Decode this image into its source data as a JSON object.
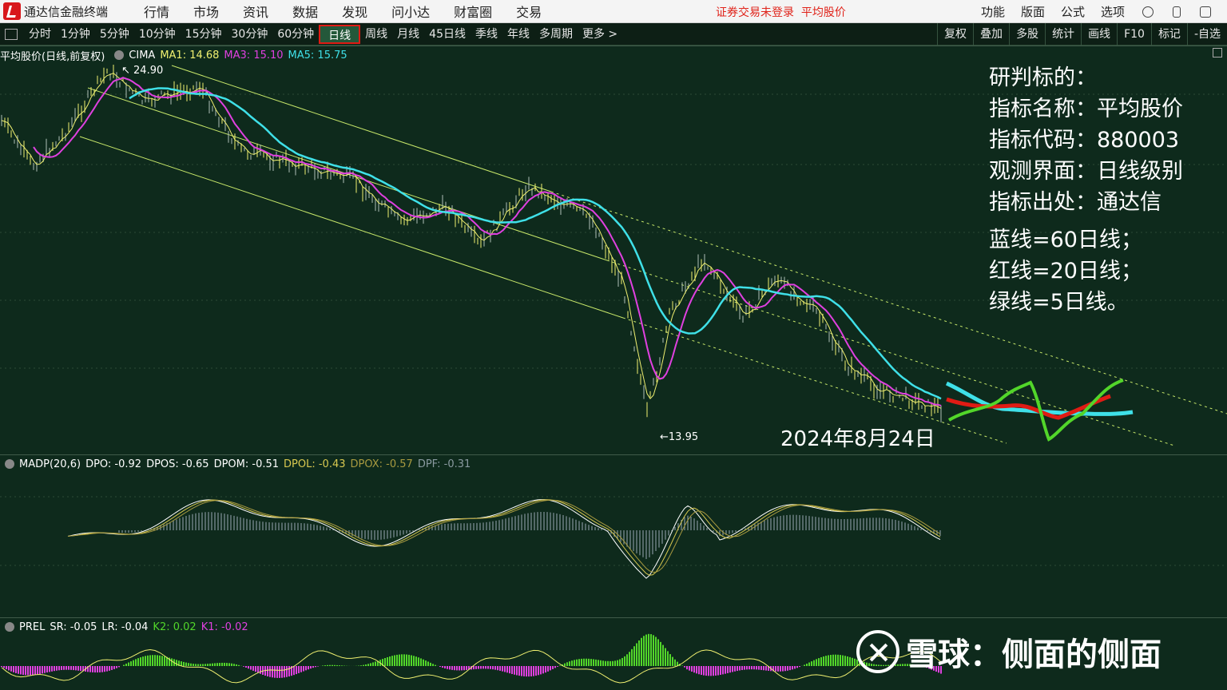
{
  "app": {
    "title": "通达信金融终端",
    "login_status": "证券交易未登录",
    "security_name": "平均股价"
  },
  "menu": [
    "行情",
    "市场",
    "资讯",
    "数据",
    "发现",
    "问小达",
    "财富圈",
    "交易"
  ],
  "right_menu": [
    "功能",
    "版面",
    "公式",
    "选项"
  ],
  "periods": [
    "分时",
    "1分钟",
    "5分钟",
    "10分钟",
    "15分钟",
    "30分钟",
    "60分钟",
    "日线",
    "周线",
    "月线",
    "45日线",
    "季线",
    "年线",
    "多周期",
    "更多 >"
  ],
  "active_period": "日线",
  "tools": [
    "复权",
    "叠加",
    "多股",
    "统计",
    "画线",
    "F10",
    "标记",
    "-自选"
  ],
  "price_pane": {
    "title": "平均股价(日线,前复权)",
    "indicator": "CIMA",
    "ma1": "MA1: 14.68",
    "ma3": "MA3: 15.10",
    "ma5": "MA5: 15.75",
    "high_label": "24.90",
    "low_label": "13.95",
    "date_label": "2024年8月24日"
  },
  "madp_pane": {
    "name": "MADP(20,6)",
    "dpo": "DPO: -0.92",
    "dpos": "DPOS: -0.65",
    "dpom": "DPOM: -0.51",
    "dpol": "DPOL: -0.43",
    "dpox": "DPOX: -0.57",
    "dpf": "DPF: -0.31"
  },
  "prel_pane": {
    "name": "PREL",
    "sr": "SR: -0.05",
    "lr": "LR: -0.04",
    "k2": "K2: 0.02",
    "k1": "K1: -0.02"
  },
  "annotation": {
    "lines": [
      "研判标的：",
      "指标名称：平均股价",
      "指标代码：880003",
      "观测界面：日线级别",
      "指标出处：通达信"
    ],
    "legend": [
      "蓝线=60日线；",
      "红线=20日线；",
      "绿线=5日线。"
    ]
  },
  "watermark": "雪球：侧面的侧面",
  "colors": {
    "ma60": "#3fe0e8",
    "ma20": "#e040e0",
    "ma5": "#f0f070",
    "channel": "#c8e86a",
    "proj_red": "#e01b14",
    "proj_green": "#52d62a",
    "proj_cyan": "#3fe0e8",
    "active_border": "#e01b14",
    "background": "#0e2a1c"
  }
}
